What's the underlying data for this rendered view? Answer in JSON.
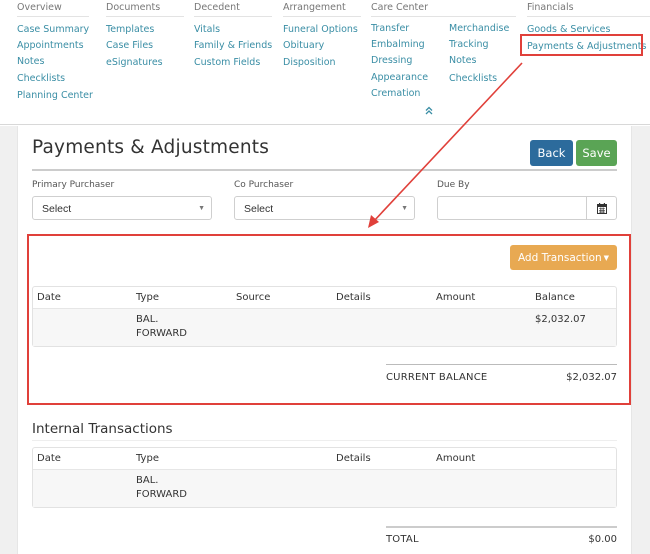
{
  "nav": {
    "columns": [
      {
        "heading": "Overview",
        "links": [
          "Case Summary",
          "Appointments",
          "Notes",
          "Checklists",
          "Planning Center"
        ]
      },
      {
        "heading": "Documents",
        "links": [
          "Templates",
          "Case Files",
          "eSignatures"
        ]
      },
      {
        "heading": "Decedent",
        "links": [
          "Vitals",
          "Family & Friends",
          "Custom Fields"
        ]
      },
      {
        "heading": "Arrangement",
        "links": [
          "Funeral Options",
          "Obituary",
          "Disposition"
        ]
      },
      {
        "heading": "Care Center",
        "links": [
          "Transfer",
          "Embalming",
          "Dressing",
          "Appearance",
          "Cremation"
        ],
        "links2": [
          "Merchandise",
          "Tracking",
          "Notes",
          "Checklists"
        ]
      },
      {
        "heading": "Financials",
        "links": [
          "Goods & Services",
          "Payments & Adjustments"
        ]
      }
    ],
    "collapse_icon": "double-chevron-up",
    "highlighted_item": "Payments & Adjustments"
  },
  "page": {
    "title": "Payments & Adjustments",
    "back_label": "Back",
    "save_label": "Save",
    "primary_purchaser": {
      "label": "Primary Purchaser",
      "value": "Select"
    },
    "co_purchaser": {
      "label": "Co Purchaser",
      "value": "Select"
    },
    "due_by": {
      "label": "Due By",
      "value": "",
      "icon": "calendar-icon"
    },
    "add_transaction_label": "Add Transaction",
    "transactions": {
      "columns": [
        "Date",
        "Type",
        "Source",
        "Details",
        "Amount",
        "Balance"
      ],
      "rows": [
        {
          "date": "",
          "type_line1": "BAL.",
          "type_line2": "FORWARD",
          "source": "",
          "details": "",
          "amount": "",
          "balance": "$2,032.07"
        }
      ],
      "summary_label": "CURRENT BALANCE",
      "summary_value": "$2,032.07"
    },
    "internal": {
      "title": "Internal Transactions",
      "columns": [
        "Date",
        "Type",
        "Details",
        "Amount"
      ],
      "rows": [
        {
          "date": "",
          "type_line1": "BAL.",
          "type_line2": "FORWARD",
          "details": "",
          "amount": ""
        }
      ],
      "summary_label": "TOTAL",
      "summary_value": "$0.00"
    }
  },
  "colors": {
    "link": "#3a8ea5",
    "back_button": "#2c6b9c",
    "save_button": "#5aa455",
    "add_button": "#e8a952",
    "annotation": "#e0403a"
  }
}
